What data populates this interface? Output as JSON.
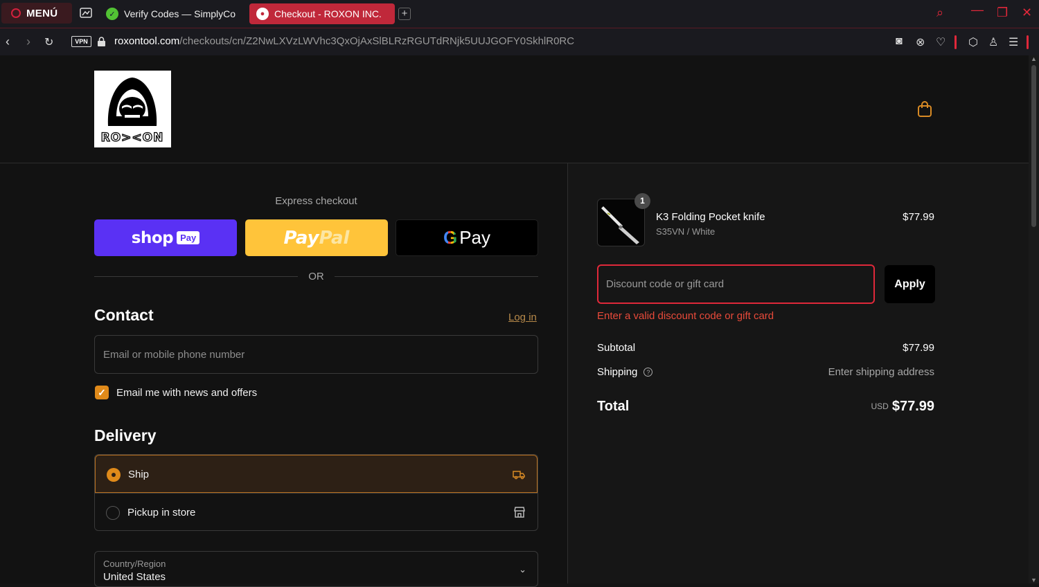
{
  "browser": {
    "menu_label": "MENÚ",
    "tabs": [
      {
        "title": "Verify Codes — SimplyCo"
      },
      {
        "title": "Checkout - ROXON INC."
      }
    ],
    "url_domain": "roxontool.com",
    "url_path": "/checkouts/cn/Z2NwLXVzLWVhc3QxOjAxSlBLRzRGUTdRNjk5UUJGOFY0SkhlR0RC",
    "vpn_label": "VPN"
  },
  "header": {
    "logo_text": "RO><ON"
  },
  "express": {
    "label": "Express checkout",
    "shop_text": "shop",
    "shop_pay_badge": "Pay",
    "paypal_pay": "Pay",
    "paypal_pal": "Pal",
    "gpay_g": "G",
    "gpay_pay": "Pay",
    "or_label": "OR"
  },
  "contact": {
    "heading": "Contact",
    "login_label": "Log in",
    "email_placeholder": "Email or mobile phone number",
    "newsletter_label": "Email me with news and offers",
    "newsletter_checked": true
  },
  "delivery": {
    "heading": "Delivery",
    "options": [
      {
        "label": "Ship",
        "selected": true,
        "icon": "truck-icon"
      },
      {
        "label": "Pickup in store",
        "selected": false,
        "icon": "store-icon"
      }
    ],
    "country_label": "Country/Region",
    "country_value": "United States"
  },
  "summary": {
    "item": {
      "quantity": "1",
      "name": "K3 Folding Pocket knife",
      "variant": "S35VN / White",
      "price": "$77.99"
    },
    "discount_placeholder": "Discount code or gift card",
    "apply_label": "Apply",
    "discount_error": "Enter a valid discount code or gift card",
    "subtotal_label": "Subtotal",
    "subtotal_value": "$77.99",
    "shipping_label": "Shipping",
    "shipping_value": "Enter shipping address",
    "total_label": "Total",
    "total_currency": "USD",
    "total_value": "$77.99"
  },
  "colors": {
    "accent": "#e08a1a",
    "error": "#e0283a",
    "shop_pay": "#5a31f4",
    "paypal": "#ffc43a"
  }
}
